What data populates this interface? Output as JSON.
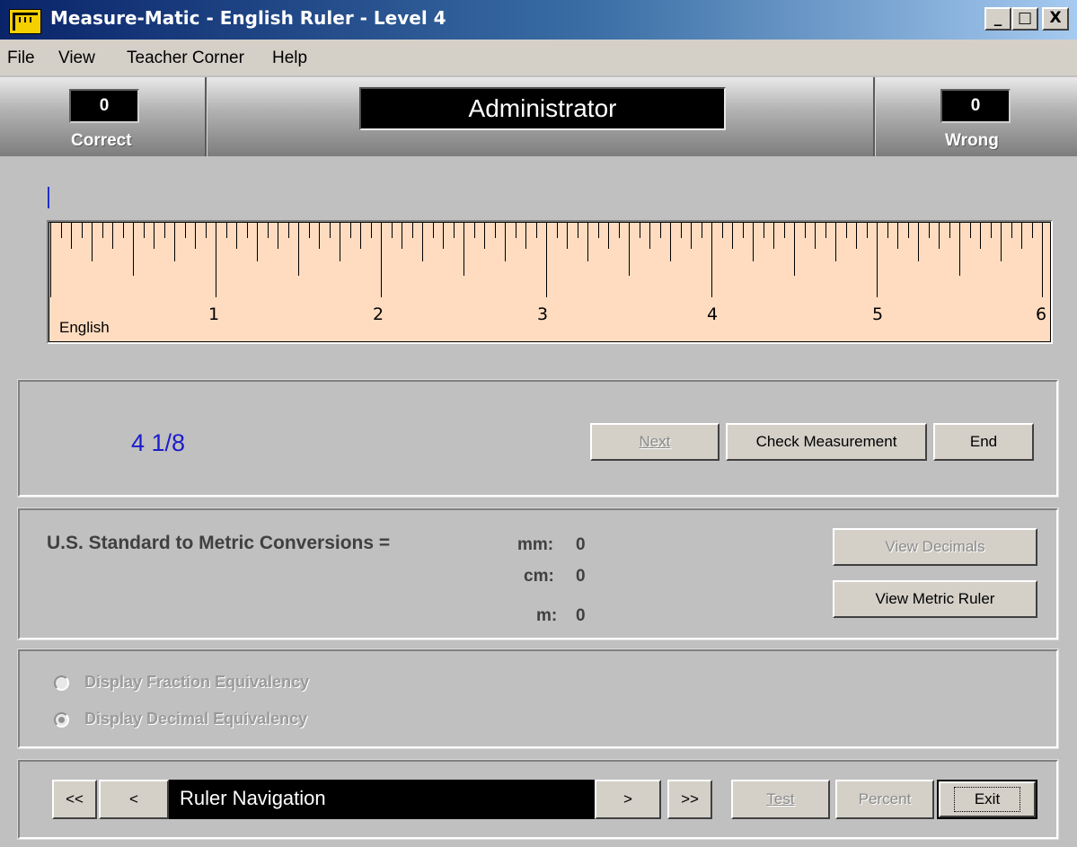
{
  "window": {
    "title": "Measure-Matic - English Ruler - Level 4",
    "controls": {
      "minimize": "_",
      "maximize": "□",
      "close": "X"
    }
  },
  "menu": [
    "File",
    "View",
    "Teacher Corner",
    "Help"
  ],
  "score": {
    "correct_value": "0",
    "correct_label": "Correct",
    "wrong_value": "0",
    "wrong_label": "Wrong",
    "user": "Administrator"
  },
  "ruler": {
    "label": "English",
    "numbers": [
      "1",
      "2",
      "3",
      "4",
      "5",
      "6"
    ],
    "inches": 6,
    "subdivisions": 16,
    "background": "#ffdcc0"
  },
  "measurement": {
    "value": "4 1/8",
    "next": "Next",
    "check": "Check Measurement",
    "end": "End"
  },
  "conversions": {
    "title": "U.S. Standard to Metric Conversions =",
    "mm_label": "mm:",
    "mm_value": "0",
    "cm_label": "cm:",
    "cm_value": "0",
    "m_label": "m:",
    "m_value": "0",
    "view_decimals": "View Decimals",
    "view_metric": "View Metric Ruler"
  },
  "equivalency": {
    "fraction": "Display Fraction Equivalency",
    "decimal": "Display Decimal Equivalency",
    "selected": "decimal"
  },
  "navigation": {
    "first": "<<",
    "prev": "<",
    "field": "Ruler Navigation",
    "next": ">",
    "last": ">>",
    "test": "Test",
    "percent": "Percent",
    "exit": "Exit"
  },
  "colors": {
    "title_gradient_start": "#0a246a",
    "measurement_text": "#1c1ccc",
    "cursor": "#2030c8"
  }
}
